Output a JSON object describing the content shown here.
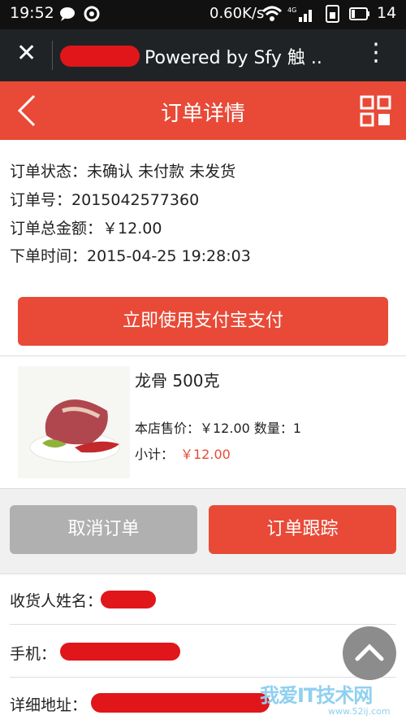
{
  "status_bar": {
    "time": "19:52",
    "network": "0.60K/s",
    "battery": "14"
  },
  "browser": {
    "title": "Powered by Sfy 触 ..",
    "close_icon": "close-icon",
    "menu_icon": "more-vert-icon"
  },
  "header": {
    "title": "订单详情",
    "back_icon": "back-icon",
    "grid_icon": "grid-icon"
  },
  "order": {
    "status_label": "订单状态：",
    "status_value": "未确认 未付款 未发货",
    "number_label": "订单号：",
    "number_value": "2015042577360",
    "total_label": "订单总金额：",
    "total_value": "￥12.00",
    "time_label": "下单时间：",
    "time_value": "2015-04-25 19:28:03"
  },
  "pay_button": "立即使用支付宝支付",
  "product": {
    "name": "龙骨 500克",
    "price_line": "本店售价：￥12.00 数量：1",
    "subtotal_label": "小计：",
    "subtotal_value": "￥12.00"
  },
  "actions": {
    "cancel": "取消订单",
    "track": "订单跟踪"
  },
  "address": {
    "receiver_label": "收货人姓名：",
    "phone_label": "手机：",
    "detail_label": "详细地址："
  },
  "watermark": {
    "text": "我爱IT技术网",
    "url": "www.52ij.com"
  },
  "colors": {
    "accent": "#e84a37",
    "gray_button": "#b0b0b0"
  }
}
